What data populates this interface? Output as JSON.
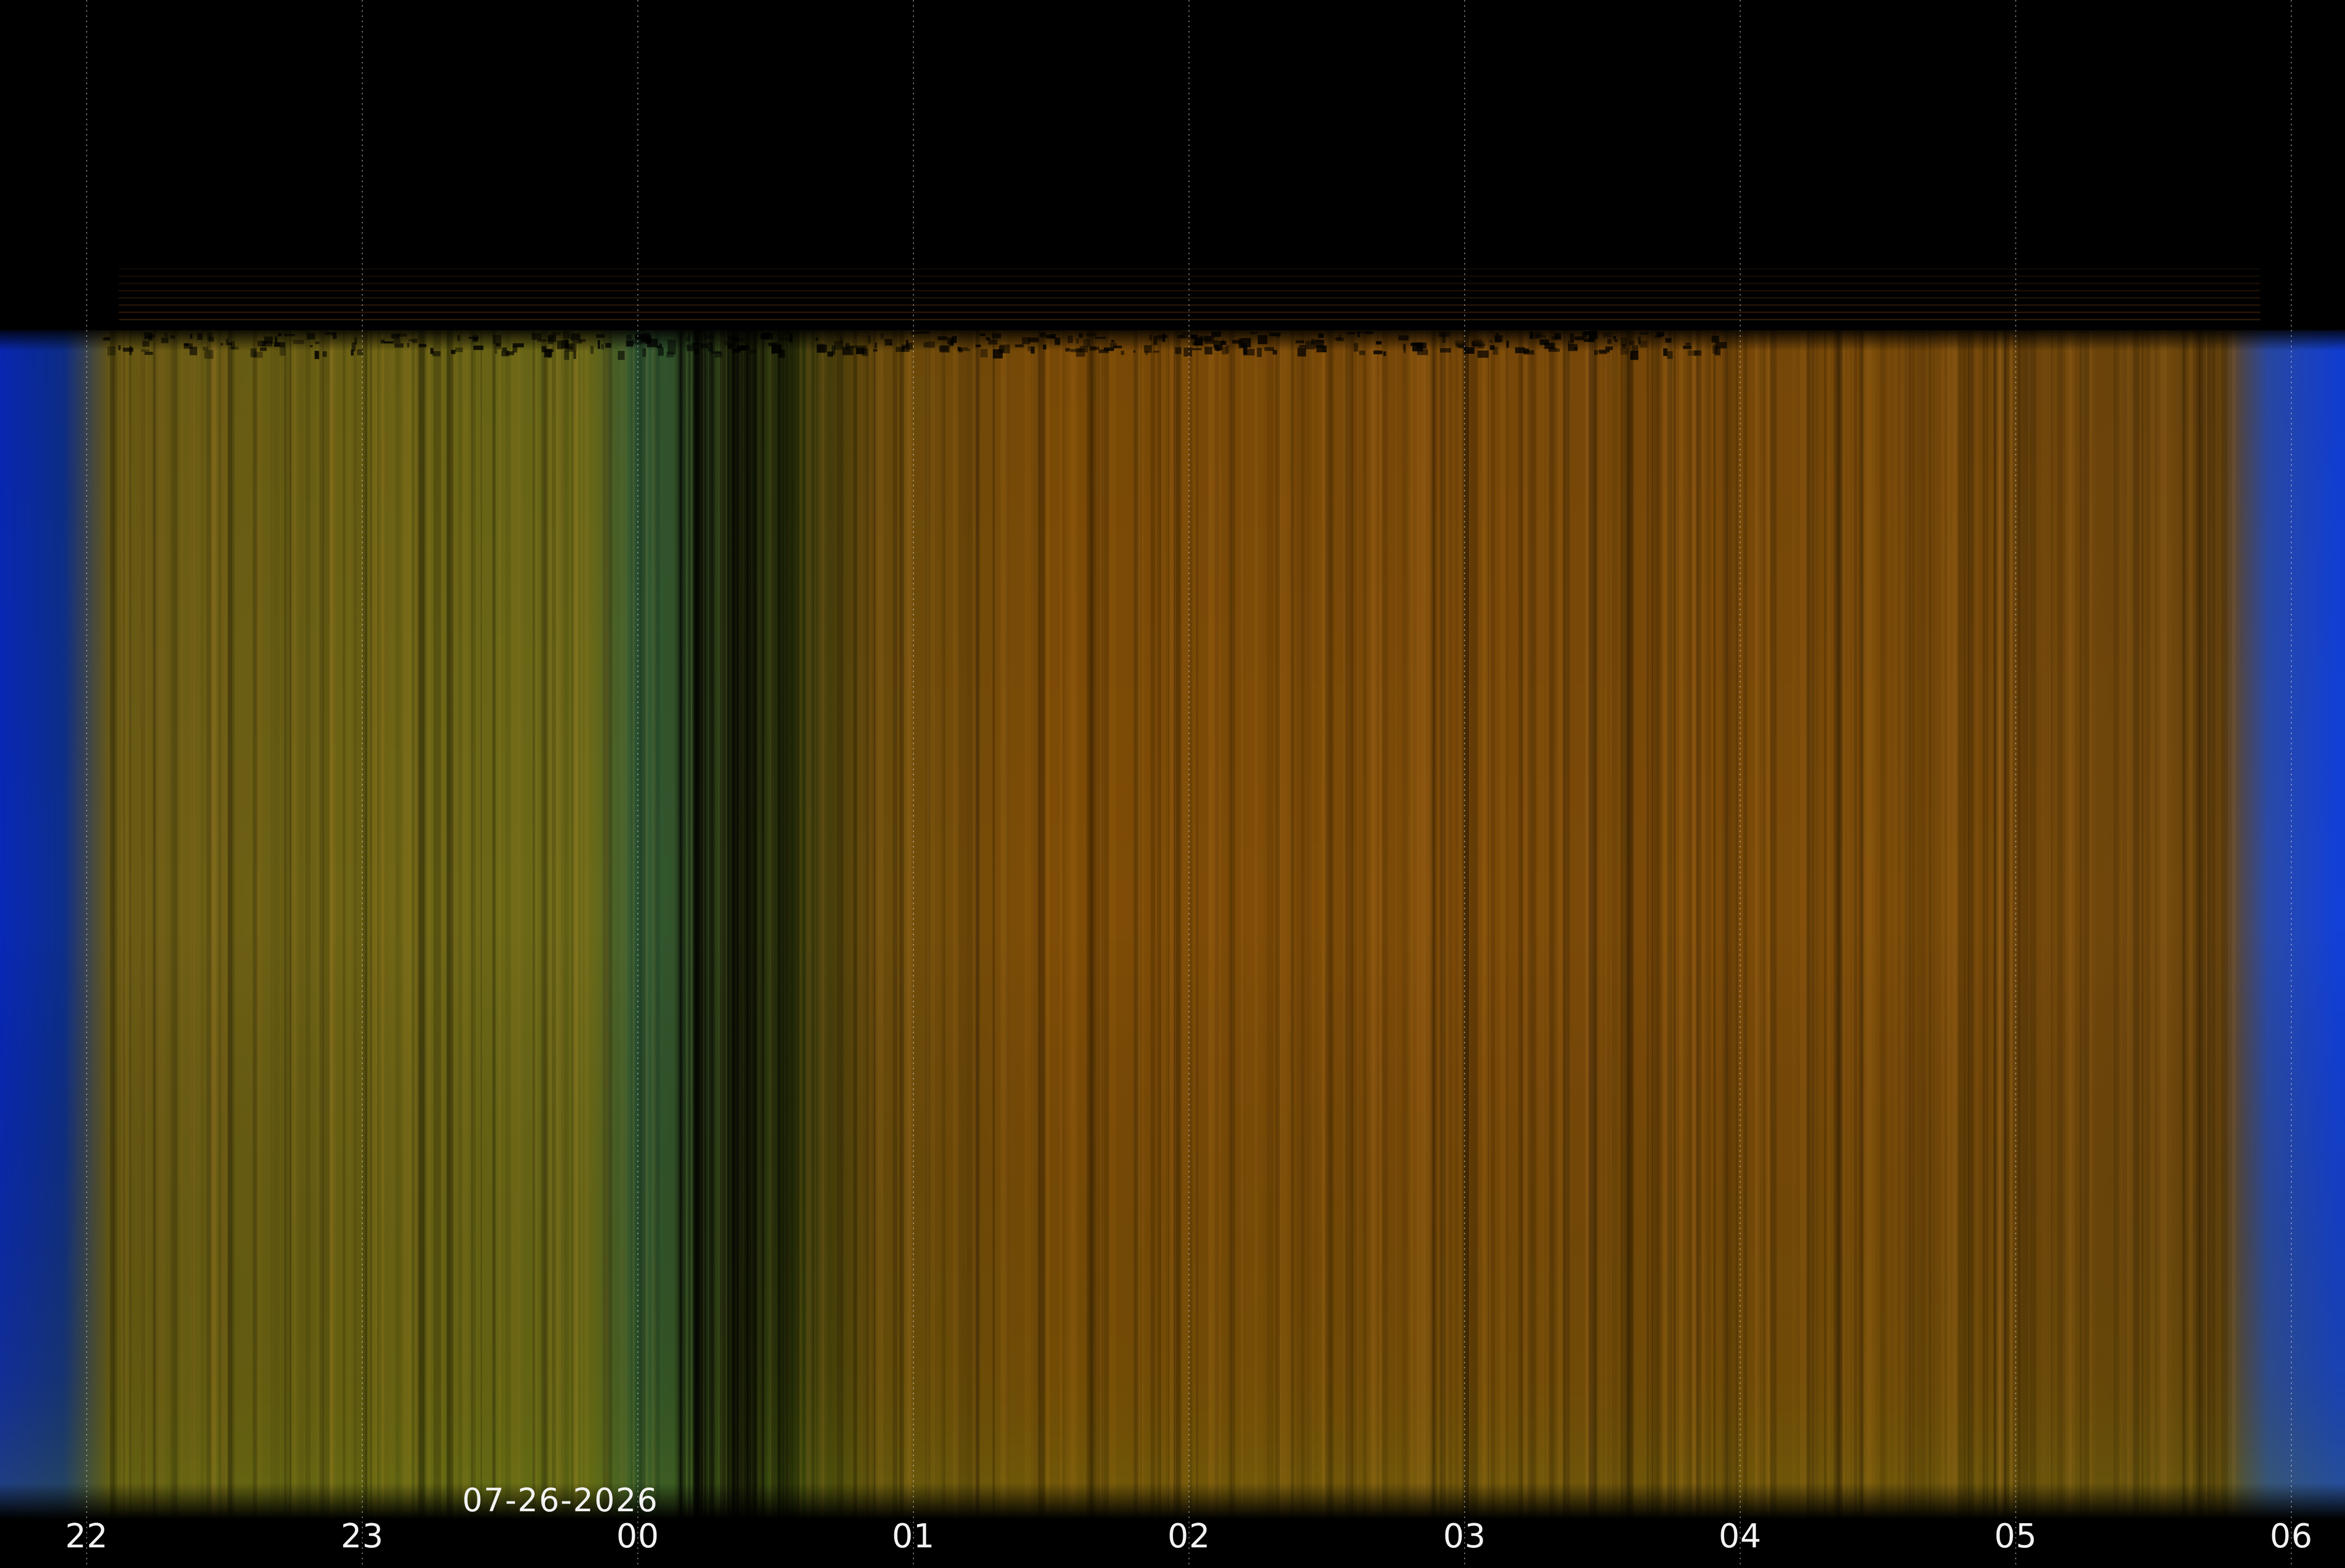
{
  "chart_data": {
    "type": "heatmap",
    "title": "",
    "xlabel": "",
    "ylabel": "",
    "x_axis": {
      "unit": "hour",
      "tick_labels": [
        "22",
        "23",
        "00",
        "01",
        "02",
        "03",
        "04",
        "05",
        "06"
      ],
      "range": [
        "22:00",
        "06:00"
      ],
      "vertical_grid": true
    },
    "date_marker": {
      "text": "07-26-2026",
      "at_hour": "00"
    },
    "sky_color_timeline": [
      {
        "time": "21:40",
        "color": "#0828b8"
      },
      {
        "time": "21:55",
        "color": "#0d2e8a"
      },
      {
        "time": "22:05",
        "color": "#6a5a14"
      },
      {
        "time": "23:00",
        "color": "#6e6414"
      },
      {
        "time": "23:50",
        "color": "#6a6a18"
      },
      {
        "time": "00:00",
        "color": "#2e5a36"
      },
      {
        "time": "00:20",
        "color": "#3a4a18"
      },
      {
        "time": "00:35",
        "color": "#2a3208"
      },
      {
        "time": "00:50",
        "color": "#6a4c0c"
      },
      {
        "time": "01:30",
        "color": "#7e4c06"
      },
      {
        "time": "03:00",
        "color": "#7c4a08"
      },
      {
        "time": "04:30",
        "color": "#7a4a08"
      },
      {
        "time": "05:45",
        "color": "#6a440c"
      },
      {
        "time": "05:55",
        "color": "#2a4aa8"
      },
      {
        "time": "06:10",
        "color": "#1240d8"
      }
    ],
    "colors": {
      "background": "#000000",
      "twilight": "#0a3adc",
      "night_orange": "#7e4a08",
      "night_green": "#5e6418",
      "aurora_teal": "#2f6a48"
    }
  }
}
